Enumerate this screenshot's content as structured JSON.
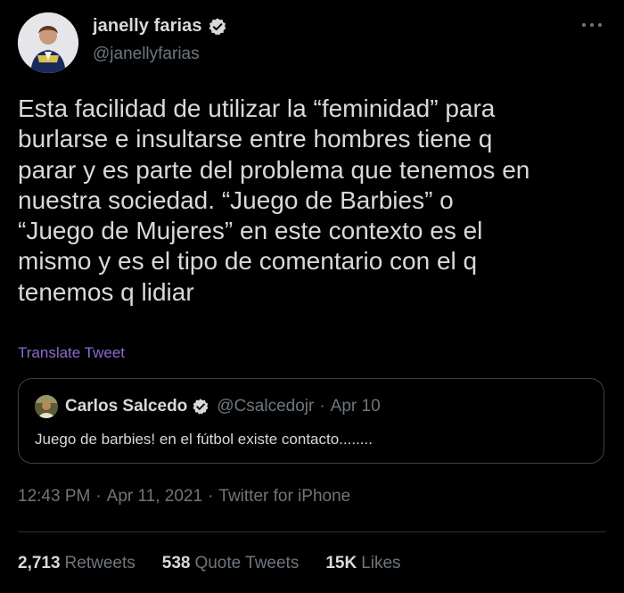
{
  "author": {
    "name": "janelly farias",
    "handle": "@janellyfarias",
    "verified": true
  },
  "menu": {
    "icon": "more-options-icon"
  },
  "tweet": {
    "lines": [
      "Esta facilidad de utilizar la “feminidad” para",
      "burlarse e insultarse entre hombres tiene q",
      "parar y es parte del problema que tenemos en",
      "nuestra sociedad. “Juego de Barbies” o",
      "“Juego de Mujeres” en este contexto es el",
      "mismo y es el tipo de comentario con el q",
      "tenemos q lidiar"
    ],
    "translate_label": "Translate Tweet"
  },
  "quote": {
    "name": "Carlos Salcedo",
    "handle": "@Csalcedojr",
    "separator": "·",
    "date": "Apr 10",
    "text": "Juego de barbies! en el fútbol existe contacto........"
  },
  "meta": {
    "time": "12:43 PM",
    "date": "Apr 11, 2021",
    "source": "Twitter for iPhone",
    "separator": "·"
  },
  "stats": {
    "retweets": {
      "value": "2,713",
      "label": "Retweets"
    },
    "quotes": {
      "value": "538",
      "label": "Quote Tweets"
    },
    "likes": {
      "value": "15K",
      "label": "Likes"
    }
  },
  "colors": {
    "background": "#000000",
    "text": "#d9d9d9",
    "secondary": "#6e767d",
    "link": "#8e6ad0",
    "verified_badge": "#d9d9d9",
    "divider": "#2f3336"
  }
}
